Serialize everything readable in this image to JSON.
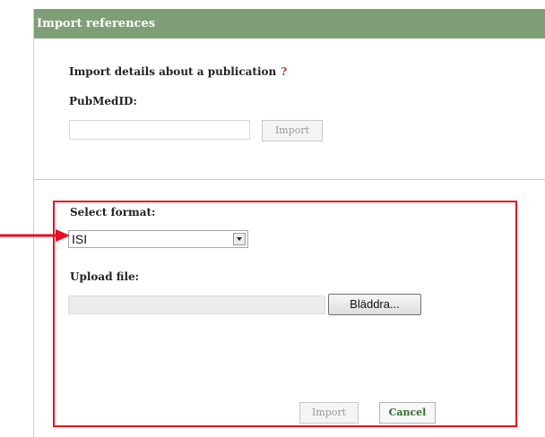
{
  "dialog": {
    "title": "Import references"
  },
  "publication": {
    "heading": "Import details about a publication",
    "help": "?",
    "pubmed_label": "PubMedID:",
    "pubmed_value": "",
    "import_label": "Import"
  },
  "upload": {
    "format_label": "Select format:",
    "format_selected": "ISI",
    "file_label": "Upload file:",
    "file_path": "",
    "browse_label": "Bläddra...",
    "import_label": "Import",
    "cancel_label": "Cancel"
  },
  "colors": {
    "titlebar": "#7e9f76",
    "highlight": "#e8101e",
    "cancel_text": "#2f6b2f",
    "help_mark": "#c0392b"
  }
}
